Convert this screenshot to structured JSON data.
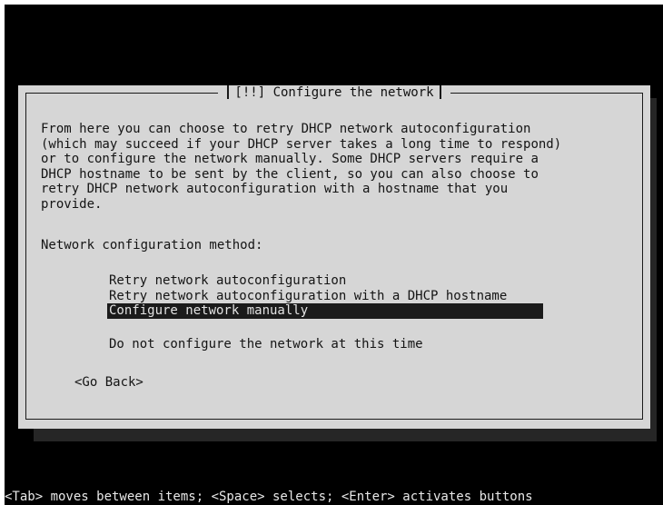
{
  "dialog": {
    "title": "[!!] Configure the network",
    "description": "From here you can choose to retry DHCP network autoconfiguration\n(which may succeed if your DHCP server takes a long time to respond)\nor to configure the network manually. Some DHCP servers require a\nDHCP hostname to be sent by the client, so you can also choose to\nretry DHCP network autoconfiguration with a hostname that you\nprovide.",
    "method_label": "Network configuration method:",
    "options": [
      {
        "label": "Retry network autoconfiguration",
        "selected": false
      },
      {
        "label": "Retry network autoconfiguration with a DHCP hostname",
        "selected": false
      },
      {
        "label": "Configure network manually",
        "selected": true
      },
      {
        "label": "Do not configure the network at this time",
        "selected": false
      }
    ],
    "go_back": "<Go Back>"
  },
  "status_bar": {
    "help": "<Tab> moves between items; <Space> selects; <Enter> activates buttons"
  }
}
